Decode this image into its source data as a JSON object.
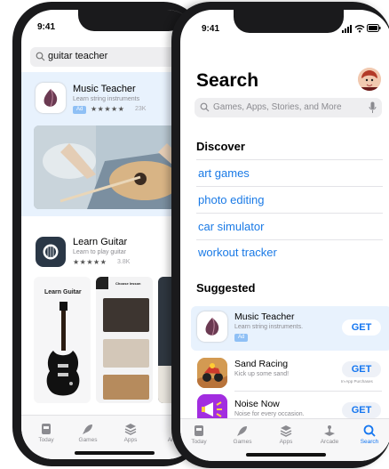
{
  "back_phone": {
    "status_time": "9:41",
    "search_value": "guitar teacher",
    "featured": {
      "name": "Music Teacher",
      "subtitle": "Learn string instruments",
      "ad_badge": "Ad",
      "rating_count": "23K"
    },
    "second": {
      "name": "Learn Guitar",
      "subtitle": "Learn to play guitar",
      "rating_count": "3.8K"
    },
    "shot1_title": "Learn Guitar",
    "shot2_title": "Choose lesson",
    "tabs": [
      "Today",
      "Games",
      "Apps",
      "Arcade"
    ]
  },
  "front_phone": {
    "status_time": "9:41",
    "title": "Search",
    "search_placeholder": "Games, Apps, Stories, and More",
    "discover_heading": "Discover",
    "discover_items": [
      "art games",
      "photo editing",
      "car simulator",
      "workout tracker"
    ],
    "suggested_heading": "Suggested",
    "suggested": [
      {
        "name": "Music Teacher",
        "subtitle": "Learn string instruments.",
        "badge": "Ad",
        "button": "GET",
        "note": ""
      },
      {
        "name": "Sand Racing",
        "subtitle": "Kick up some sand!",
        "badge": "",
        "button": "GET",
        "note": "In-App Purchases"
      },
      {
        "name": "Noise Now",
        "subtitle": "Noise for every occasion.",
        "badge": "",
        "button": "GET",
        "note": ""
      }
    ],
    "tabs": [
      "Today",
      "Games",
      "Apps",
      "Arcade",
      "Search"
    ]
  },
  "colors": {
    "accent": "#1476f0",
    "highlight": "#e8f2fd",
    "frame": "#1a1a1c"
  }
}
